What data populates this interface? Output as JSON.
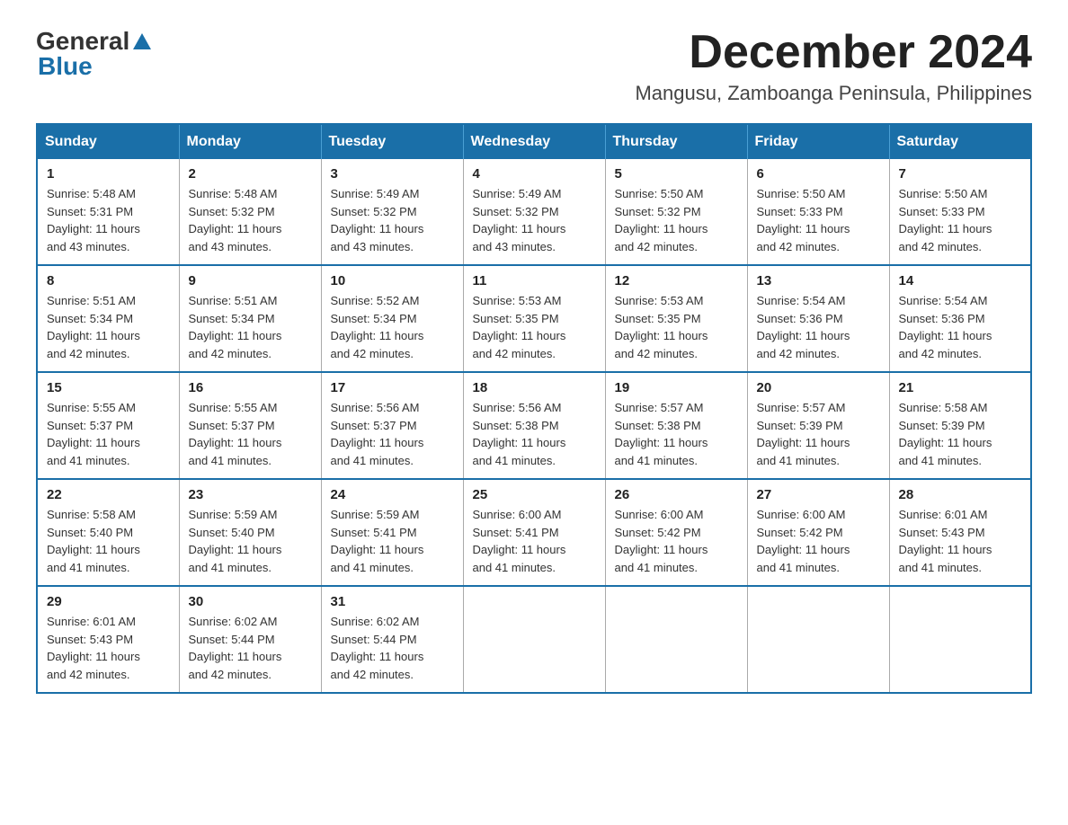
{
  "header": {
    "logo_general": "General",
    "logo_blue": "Blue",
    "month_title": "December 2024",
    "location": "Mangusu, Zamboanga Peninsula, Philippines"
  },
  "weekdays": [
    "Sunday",
    "Monday",
    "Tuesday",
    "Wednesday",
    "Thursday",
    "Friday",
    "Saturday"
  ],
  "weeks": [
    [
      {
        "day": "1",
        "sunrise": "5:48 AM",
        "sunset": "5:31 PM",
        "daylight": "11 hours and 43 minutes."
      },
      {
        "day": "2",
        "sunrise": "5:48 AM",
        "sunset": "5:32 PM",
        "daylight": "11 hours and 43 minutes."
      },
      {
        "day": "3",
        "sunrise": "5:49 AM",
        "sunset": "5:32 PM",
        "daylight": "11 hours and 43 minutes."
      },
      {
        "day": "4",
        "sunrise": "5:49 AM",
        "sunset": "5:32 PM",
        "daylight": "11 hours and 43 minutes."
      },
      {
        "day": "5",
        "sunrise": "5:50 AM",
        "sunset": "5:32 PM",
        "daylight": "11 hours and 42 minutes."
      },
      {
        "day": "6",
        "sunrise": "5:50 AM",
        "sunset": "5:33 PM",
        "daylight": "11 hours and 42 minutes."
      },
      {
        "day": "7",
        "sunrise": "5:50 AM",
        "sunset": "5:33 PM",
        "daylight": "11 hours and 42 minutes."
      }
    ],
    [
      {
        "day": "8",
        "sunrise": "5:51 AM",
        "sunset": "5:34 PM",
        "daylight": "11 hours and 42 minutes."
      },
      {
        "day": "9",
        "sunrise": "5:51 AM",
        "sunset": "5:34 PM",
        "daylight": "11 hours and 42 minutes."
      },
      {
        "day": "10",
        "sunrise": "5:52 AM",
        "sunset": "5:34 PM",
        "daylight": "11 hours and 42 minutes."
      },
      {
        "day": "11",
        "sunrise": "5:53 AM",
        "sunset": "5:35 PM",
        "daylight": "11 hours and 42 minutes."
      },
      {
        "day": "12",
        "sunrise": "5:53 AM",
        "sunset": "5:35 PM",
        "daylight": "11 hours and 42 minutes."
      },
      {
        "day": "13",
        "sunrise": "5:54 AM",
        "sunset": "5:36 PM",
        "daylight": "11 hours and 42 minutes."
      },
      {
        "day": "14",
        "sunrise": "5:54 AM",
        "sunset": "5:36 PM",
        "daylight": "11 hours and 42 minutes."
      }
    ],
    [
      {
        "day": "15",
        "sunrise": "5:55 AM",
        "sunset": "5:37 PM",
        "daylight": "11 hours and 41 minutes."
      },
      {
        "day": "16",
        "sunrise": "5:55 AM",
        "sunset": "5:37 PM",
        "daylight": "11 hours and 41 minutes."
      },
      {
        "day": "17",
        "sunrise": "5:56 AM",
        "sunset": "5:37 PM",
        "daylight": "11 hours and 41 minutes."
      },
      {
        "day": "18",
        "sunrise": "5:56 AM",
        "sunset": "5:38 PM",
        "daylight": "11 hours and 41 minutes."
      },
      {
        "day": "19",
        "sunrise": "5:57 AM",
        "sunset": "5:38 PM",
        "daylight": "11 hours and 41 minutes."
      },
      {
        "day": "20",
        "sunrise": "5:57 AM",
        "sunset": "5:39 PM",
        "daylight": "11 hours and 41 minutes."
      },
      {
        "day": "21",
        "sunrise": "5:58 AM",
        "sunset": "5:39 PM",
        "daylight": "11 hours and 41 minutes."
      }
    ],
    [
      {
        "day": "22",
        "sunrise": "5:58 AM",
        "sunset": "5:40 PM",
        "daylight": "11 hours and 41 minutes."
      },
      {
        "day": "23",
        "sunrise": "5:59 AM",
        "sunset": "5:40 PM",
        "daylight": "11 hours and 41 minutes."
      },
      {
        "day": "24",
        "sunrise": "5:59 AM",
        "sunset": "5:41 PM",
        "daylight": "11 hours and 41 minutes."
      },
      {
        "day": "25",
        "sunrise": "6:00 AM",
        "sunset": "5:41 PM",
        "daylight": "11 hours and 41 minutes."
      },
      {
        "day": "26",
        "sunrise": "6:00 AM",
        "sunset": "5:42 PM",
        "daylight": "11 hours and 41 minutes."
      },
      {
        "day": "27",
        "sunrise": "6:00 AM",
        "sunset": "5:42 PM",
        "daylight": "11 hours and 41 minutes."
      },
      {
        "day": "28",
        "sunrise": "6:01 AM",
        "sunset": "5:43 PM",
        "daylight": "11 hours and 41 minutes."
      }
    ],
    [
      {
        "day": "29",
        "sunrise": "6:01 AM",
        "sunset": "5:43 PM",
        "daylight": "11 hours and 42 minutes."
      },
      {
        "day": "30",
        "sunrise": "6:02 AM",
        "sunset": "5:44 PM",
        "daylight": "11 hours and 42 minutes."
      },
      {
        "day": "31",
        "sunrise": "6:02 AM",
        "sunset": "5:44 PM",
        "daylight": "11 hours and 42 minutes."
      },
      null,
      null,
      null,
      null
    ]
  ],
  "labels": {
    "sunrise": "Sunrise:",
    "sunset": "Sunset:",
    "daylight": "Daylight:"
  }
}
